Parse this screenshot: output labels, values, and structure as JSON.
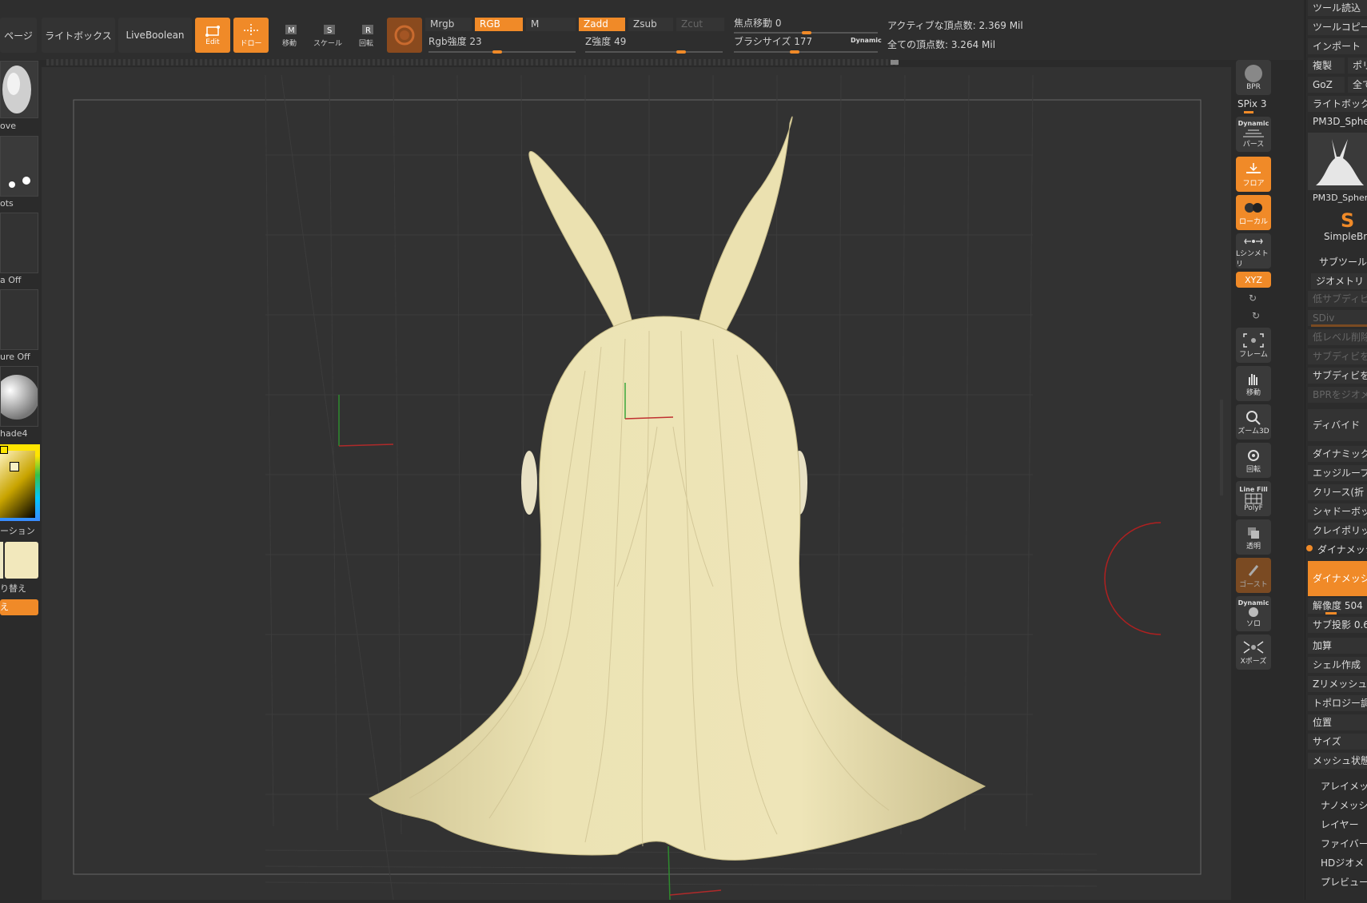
{
  "toolbar": {
    "page_label": "ページ",
    "lightbox_label": "ライトボックス",
    "liveboolean_label": "LiveBoolean",
    "edit_label": "Edit",
    "draw_label": "ドロー",
    "move_label": "移動",
    "scale_label": "スケール",
    "rotate_label": "回転",
    "mrgb_label": "Mrgb",
    "rgb_label": "RGB",
    "m_label": "M",
    "zadd_label": "Zadd",
    "zsub_label": "Zsub",
    "zcut_label": "Zcut",
    "rgb_intensity_label": "Rgb強度",
    "rgb_intensity_value": "23",
    "z_intensity_label": "Z強度",
    "z_intensity_value": "49",
    "focal_shift_label": "焦点移動",
    "focal_shift_value": "0",
    "brush_size_label": "ブラシサイズ",
    "brush_size_value": "177",
    "dynamic_label": "Dynamic",
    "active_points": "アクティブな頂点数: 2.369 Mil",
    "total_points": "全ての頂点数: 3.264 Mil"
  },
  "left_panel": {
    "brush_label": "ove",
    "stroke_label": "ots",
    "alpha_label": "a Off",
    "texture_label": "ure Off",
    "material_label": "hade4",
    "gradient_label": "ーション",
    "switch_label": "り替え",
    "orange_btn_label": "え"
  },
  "right_shelf": {
    "bpr_label": "BPR",
    "spix_label": "SPix 3",
    "dynamic_label": "Dynamic",
    "perspective_label": "パース",
    "floor_label": "フロア",
    "local_label": "ローカル",
    "symmetry_label": "Lシンメトリ",
    "xyz_label": "XYZ",
    "frame_label": "フレーム",
    "move_label": "移動",
    "zoom3d_label": "ズーム3D",
    "rotate_label": "回転",
    "linefill_label": "Line Fill",
    "polyf_label": "PolyF",
    "transp_label": "透明",
    "ghost_label": "ゴースト",
    "solo_dynamic_label": "Dynamic",
    "solo_label": "ソロ",
    "xpose_label": "Xポーズ"
  },
  "tool_palette": {
    "items": [
      {
        "label": "ツール読込"
      },
      {
        "label": "ツールコピー"
      },
      {
        "label": "インポート"
      },
      {
        "label": "複製"
      },
      {
        "label": "ポリ"
      },
      {
        "label": "GoZ"
      },
      {
        "label": "全て"
      },
      {
        "label": "ライトボック"
      },
      {
        "label": "PM3D_Sphe"
      }
    ],
    "thumb_label": "PM3D_Spher",
    "simplebrush_label": "SimpleBrus",
    "subtool_label": "サブツール",
    "geometry_label": "ジオメトリ",
    "geometry_items": [
      {
        "label": "低サブディビ",
        "dim": true
      },
      {
        "label": "SDiv",
        "dim": true
      },
      {
        "label": "低レベル削除",
        "dim": true
      },
      {
        "label": "サブディビを",
        "dim": true
      },
      {
        "label": "サブディビを",
        "dim": false
      },
      {
        "label": "BPRをジオメ",
        "dim": true
      }
    ],
    "divide_label": "ディバイド",
    "sub_items": [
      {
        "label": "ダイナミック"
      },
      {
        "label": "エッジループ"
      },
      {
        "label": "クリース(折"
      },
      {
        "label": "シャドーボッ"
      },
      {
        "label": "クレイポリッ"
      },
      {
        "label": "ダイナメッシ"
      }
    ],
    "dynamesh_btn": "ダイナメッシ",
    "resolution_label": "解像度 504",
    "subproj_label": "サブ投影 0.6",
    "lower_items": [
      {
        "label": "加算"
      },
      {
        "label": "シェル作成"
      },
      {
        "label": "Zリメッシュ"
      },
      {
        "label": "トポロジー調"
      },
      {
        "label": "位置"
      },
      {
        "label": "サイズ"
      },
      {
        "label": "メッシュ状態"
      }
    ],
    "bottom_items": [
      {
        "label": "アレイメッシ"
      },
      {
        "label": "ナノメッシュ"
      },
      {
        "label": "レイヤー"
      },
      {
        "label": "ファイバー"
      },
      {
        "label": "HDジオメト"
      },
      {
        "label": "プレビュー"
      }
    ]
  },
  "colors": {
    "accent": "#f08a28",
    "model": "#ece3b4",
    "background": "#2a2a2a"
  }
}
